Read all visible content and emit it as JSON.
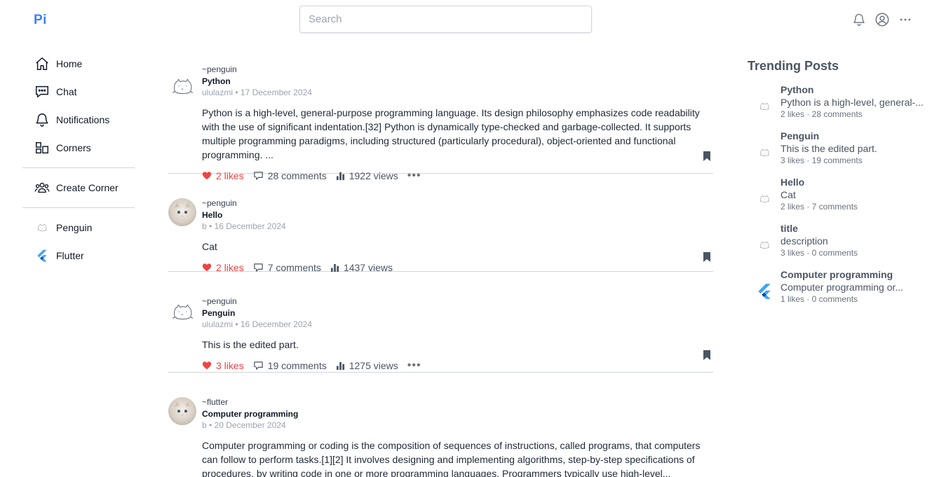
{
  "header": {
    "logo": "Pi",
    "search_placeholder": "Search",
    "icons": [
      "bell-icon",
      "user-circle-icon",
      "more-icon"
    ]
  },
  "sidebar": {
    "nav": [
      {
        "label": "Home",
        "icon": "home-icon"
      },
      {
        "label": "Chat",
        "icon": "chat-icon"
      },
      {
        "label": "Notifications",
        "icon": "bell-icon"
      },
      {
        "label": "Corners",
        "icon": "corners-icon"
      }
    ],
    "create_label": "Create Corner",
    "corners": [
      {
        "label": "Penguin",
        "icon": "penguin-sketch-icon"
      },
      {
        "label": "Flutter",
        "icon": "flutter-logo-icon"
      }
    ]
  },
  "feed": {
    "posts": [
      {
        "corner": "~penguin",
        "title": "Python",
        "meta": "ululazmi • 17 December 2024",
        "text": "Python is a high-level, general-purpose programming language. Its design philosophy emphasizes code readability with the use of significant indentation.[32] Python is dynamically type-checked and garbage-collected. It supports multiple programming paradigms, including structured (particularly procedural), object-oriented and functional programming. ...",
        "likes": "2 likes",
        "comments": "28 comments",
        "views": "1922 views",
        "avatar": "sketch"
      },
      {
        "corner": "~penguin",
        "title": "Hello",
        "meta": "b • 16 December 2024",
        "text": "Cat",
        "likes": "2 likes",
        "comments": "7 comments",
        "views": "1437 views",
        "avatar": "cat"
      },
      {
        "corner": "~penguin",
        "title": "Penguin",
        "meta": "ululazmi • 16 December 2024",
        "text": "This is the edited part.",
        "likes": "3 likes",
        "comments": "19 comments",
        "views": "1275 views",
        "avatar": "sketch"
      },
      {
        "corner": "~flutter",
        "title": "Computer programming",
        "meta": "b • 20 December 2024",
        "text": "Computer programming or coding is the composition of sequences of instructions, called programs, that computers can follow to perform tasks.[1][2] It involves designing and implementing algorithms, step-by-step specifications of procedures, by writing code in one or more programming languages. Programmers typically use high-level...",
        "avatar": "cat"
      }
    ]
  },
  "trending": {
    "title": "Trending Posts",
    "items": [
      {
        "name": "Python",
        "desc": "Python is a high-level, general-...",
        "stats": "2 likes · 28 comments",
        "icon": "penguin-sketch-icon"
      },
      {
        "name": "Penguin",
        "desc": "This is the edited part.",
        "stats": "3 likes · 19 comments",
        "icon": "penguin-sketch-icon"
      },
      {
        "name": "Hello",
        "desc": "Cat",
        "stats": "2 likes · 7 comments",
        "icon": "penguin-sketch-icon"
      },
      {
        "name": "title",
        "desc": "description",
        "stats": "3 likes · 0 comments",
        "icon": "penguin-sketch-icon"
      },
      {
        "name": "Computer programming",
        "desc": "Computer programming or...",
        "stats": "1 likes · 0 comments",
        "icon": "flutter-logo-icon"
      }
    ]
  },
  "colors": {
    "accent": "#3b82f6",
    "like": "#ef4444",
    "flutter_light": "#42a5f5",
    "flutter_dark": "#0d47a1"
  }
}
